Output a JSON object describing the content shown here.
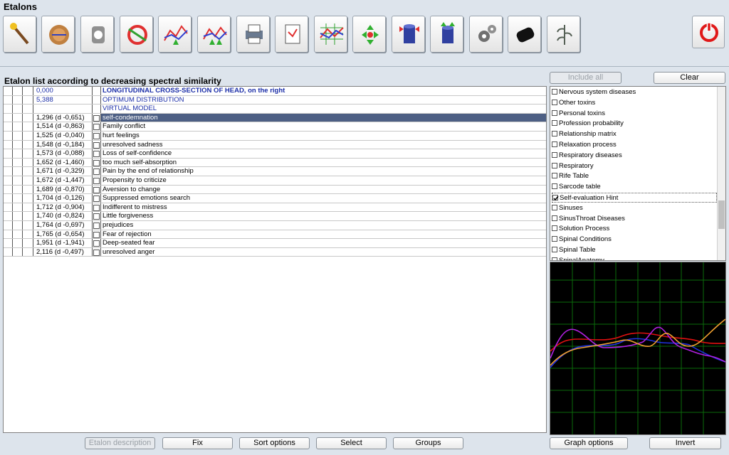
{
  "window": {
    "title": "Etalons"
  },
  "toolbar": {
    "tools": [
      "wand-icon",
      "brain-icon",
      "body-icon",
      "spectrum-icon",
      "graph-up-icon",
      "graph-compare-icon",
      "printer-icon",
      "report-icon",
      "chart-grid-icon",
      "arrows-icon",
      "cylinder-down-icon",
      "cylinder-up-icon",
      "gears-icon",
      "device-icon",
      "plant-icon"
    ],
    "close": "power-icon"
  },
  "list": {
    "title": "Etalon list according to decreasing spectral similarity",
    "rows": [
      {
        "value": "0,000",
        "name": "LONGITUDINAL CROSS-SECTION OF HEAD,  on the right",
        "style": "header-bold"
      },
      {
        "value": "5,388",
        "name": "OPTIMUM DISTRIBUTION",
        "style": "header"
      },
      {
        "value": "",
        "name": "VIRTUAL MODEL",
        "style": "header"
      },
      {
        "value": "1,296 (d -0,651)",
        "name": "self-condemnation",
        "style": "selected"
      },
      {
        "value": "1,514 (d -0,863)",
        "name": "Family conflict"
      },
      {
        "value": "1,525 (d -0,040)",
        "name": "hurt feelings"
      },
      {
        "value": "1,548 (d -0,184)",
        "name": "unresolved sadness"
      },
      {
        "value": "1,573 (d -0,088)",
        "name": "Loss of self-confidence"
      },
      {
        "value": "1,652 (d -1,460)",
        "name": "too much self-absorption"
      },
      {
        "value": "1,671 (d -0,329)",
        "name": "Pain by the end of relationship"
      },
      {
        "value": "1,672 (d -1,447)",
        "name": "Propensity to criticize"
      },
      {
        "value": "1,689 (d -0,870)",
        "name": "Aversion to change"
      },
      {
        "value": "1,704 (d -0,126)",
        "name": "Suppressed emotions search"
      },
      {
        "value": "1,712 (d -0,904)",
        "name": "Indifferent to mistress"
      },
      {
        "value": "1,740 (d -0,824)",
        "name": "Little forgiveness"
      },
      {
        "value": "1,764 (d -0,697)",
        "name": "prejudices"
      },
      {
        "value": "1,765 (d -0,654)",
        "name": "Fear of rejection"
      },
      {
        "value": "1,951 (d -1,941)",
        "name": "Deep-seated fear"
      },
      {
        "value": "2,116 (d -0,497)",
        "name": "unresolved anger"
      }
    ]
  },
  "bottom_buttons": {
    "etalon_description": "Etalon description",
    "fix": "Fix",
    "sort_options": "Sort options",
    "select": "Select",
    "groups": "Groups"
  },
  "right_buttons": {
    "include_all": "Include all",
    "clear": "Clear",
    "graph_options": "Graph options",
    "invert": "Invert"
  },
  "categories": [
    {
      "label": "Nervous system diseases",
      "checked": false
    },
    {
      "label": "Other toxins",
      "checked": false
    },
    {
      "label": "Personal toxins",
      "checked": false
    },
    {
      "label": "Profession probability",
      "checked": false
    },
    {
      "label": "Relationship matrix",
      "checked": false
    },
    {
      "label": "Relaxation process",
      "checked": false
    },
    {
      "label": "Respiratory diseases",
      "checked": false
    },
    {
      "label": "Respiratory",
      "checked": false
    },
    {
      "label": "Rife Table",
      "checked": false
    },
    {
      "label": "Sarcode table",
      "checked": false
    },
    {
      "label": "Self-evaluation Hint",
      "checked": true
    },
    {
      "label": "Sinuses",
      "checked": false
    },
    {
      "label": "SinusThroat Diseases",
      "checked": false
    },
    {
      "label": "Solution Process",
      "checked": false
    },
    {
      "label": "Spinal Conditions",
      "checked": false
    },
    {
      "label": "Spinal Table",
      "checked": false
    },
    {
      "label": "SpinalAnatomy",
      "checked": false
    }
  ],
  "colors": {
    "grid": "#0a6b0a",
    "red": "#e01010",
    "blue": "#2030e0",
    "purple": "#b020e0",
    "orange": "#f0a030"
  }
}
